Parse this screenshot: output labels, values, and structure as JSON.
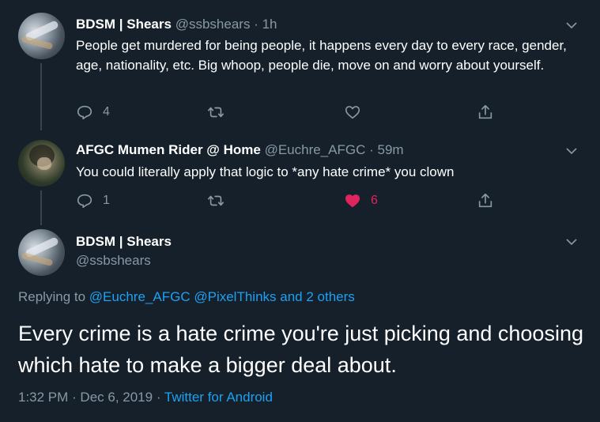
{
  "tweets": [
    {
      "name": "BDSM | Shears",
      "handle": "@ssbshears",
      "time": "1h",
      "text": "People get murdered for being people, it happens every day to every race, gender, age, nationality, etc. Big whoop, people die, move on and worry about yourself.",
      "replies": "4",
      "retweets": "",
      "likes": ""
    },
    {
      "name": "AFGC Mumen Rider @ Home",
      "handle": "@Euchre_AFGC",
      "time": "59m",
      "text": "You could literally apply that logic to *any hate crime* you clown",
      "replies": "1",
      "retweets": "",
      "likes": "6"
    }
  ],
  "focused": {
    "name": "BDSM | Shears",
    "handle": "@ssbshears",
    "replying_prefix": "Replying to",
    "replying_to": [
      "@Euchre_AFGC",
      "@PixelThinks"
    ],
    "replying_others": "and 2 others",
    "text": "Every crime is a hate crime you're just picking and choosing which hate to make a bigger deal about.",
    "timestamp": "1:32 PM · Dec 6, 2019 ·",
    "source": "Twitter for Android"
  },
  "colors": {
    "background": "#15202b",
    "secondary_text": "#8899a6",
    "link": "#1da1f2",
    "like_active": "#e0245e"
  },
  "icons": [
    "reply-icon",
    "retweet-icon",
    "like-icon",
    "share-icon",
    "chevron-down-icon"
  ]
}
